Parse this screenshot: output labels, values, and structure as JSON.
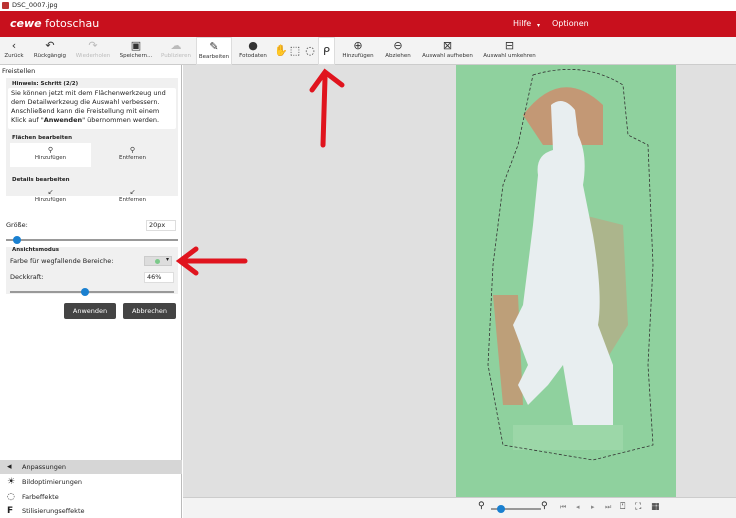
{
  "window_title": "DSC_0007.jpg",
  "header": {
    "logo_brand": "cewe",
    "logo_text": "fotoschau",
    "menu": [
      "Hilfe",
      "Optionen"
    ]
  },
  "toolbar": {
    "items": [
      {
        "label": "Zurück",
        "icon": "back-icon",
        "enabled": true
      },
      {
        "label": "Rückgängig",
        "icon": "undo-icon",
        "enabled": true
      },
      {
        "label": "Wiederholen",
        "icon": "redo-icon",
        "enabled": false
      },
      {
        "label": "Speichern...",
        "icon": "save-icon",
        "enabled": true
      },
      {
        "label": "Publizieren",
        "icon": "publish-icon",
        "enabled": false
      },
      {
        "label": "Bearbeiten",
        "icon": "edit-icon",
        "enabled": true,
        "active": true
      },
      {
        "label": "Fotodaten",
        "icon": "info-icon",
        "enabled": true
      }
    ],
    "selection_tools": [
      "hand-icon",
      "rect-select-icon",
      "ellipse-select-icon",
      "lasso-icon"
    ],
    "lasso_actions": [
      {
        "label": "Hinzufügen"
      },
      {
        "label": "Abziehen"
      },
      {
        "label": "Auswahl aufheben"
      },
      {
        "label": "Auswahl umkehren"
      }
    ]
  },
  "panel": {
    "title": "Freistellen",
    "hint_title": "Hinweis: Schritt (2/2)",
    "hint_text_1": "Sie können jetzt mit dem Flächenwerkzeug und dem Detailwerkzeug die Auswahl verbessern. Anschließend kann die Freistellung mit einem Klick auf \"",
    "hint_bold": "Anwenden",
    "hint_text_2": "\" übernommen werden.",
    "areas_title": "Flächen bearbeiten",
    "areas_add": "Hinzufügen",
    "areas_remove": "Entfernen",
    "details_title": "Details bearbeiten",
    "details_add": "Hinzufügen",
    "details_remove": "Entfernen",
    "size_label": "Größe:",
    "size_value": "20px",
    "size_slider_percent": 4,
    "view_title": "Ansichtsmodus",
    "color_label": "Farbe für wegfallende Bereiche:",
    "color_value": "#7cc98a",
    "opacity_label": "Deckkraft:",
    "opacity_value": "46%",
    "opacity_percent": 46,
    "apply": "Anwenden",
    "cancel": "Abbrechen"
  },
  "nav": [
    {
      "label": "Anpassungen",
      "icon": "arrow-left-icon"
    },
    {
      "label": "Bildoptimierungen",
      "icon": "sun-icon"
    },
    {
      "label": "Farbeffekte",
      "icon": "palette-icon"
    },
    {
      "label": "Stilisierungseffekte",
      "icon": "fx-icon"
    }
  ],
  "colors": {
    "brand": "#c8101d",
    "mask_green": "#8fd19e",
    "annotation": "#e0141e"
  }
}
